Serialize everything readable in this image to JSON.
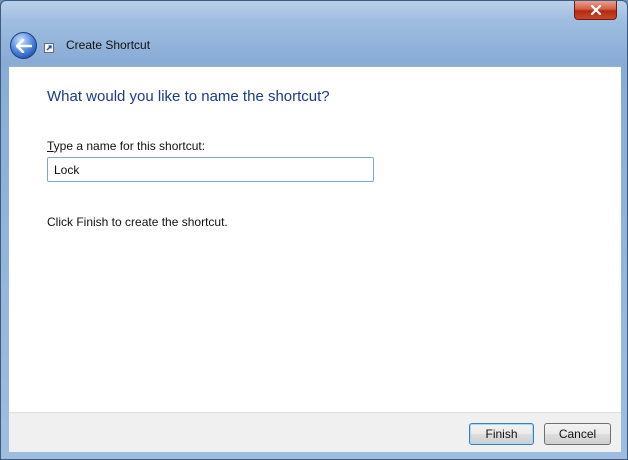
{
  "window": {
    "title": "Create Shortcut",
    "close_icon": "close-icon",
    "back_icon": "back-arrow-icon",
    "title_icon": "shortcut-icon"
  },
  "main": {
    "heading": "What would you like to name the shortcut?",
    "field_label_accesskey": "T",
    "field_label_rest": "ype a name for this shortcut:",
    "name_value": "Lock",
    "hint": "Click Finish to create the shortcut."
  },
  "footer": {
    "finish_label": "Finish",
    "cancel_label": "Cancel"
  },
  "colors": {
    "heading": "#1a3a8f",
    "close_button": "#c9462b",
    "input_border": "#7ba8d4"
  }
}
